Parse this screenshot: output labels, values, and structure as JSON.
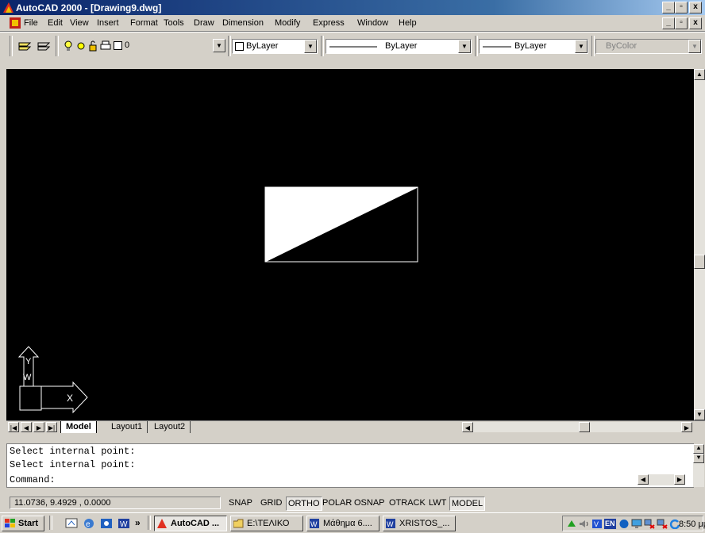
{
  "window": {
    "title": "AutoCAD 2000 - [Drawing9.dwg]"
  },
  "menu": {
    "items": [
      "File",
      "Edit",
      "View",
      "Insert",
      "Format",
      "Tools",
      "Draw",
      "Dimension",
      "Modify",
      "Express",
      "Window",
      "Help"
    ]
  },
  "toolbar": {
    "layer_value": "0",
    "color_value": "ByLayer",
    "linetype_value": "ByLayer",
    "lineweight_value": "ByLayer",
    "plotstyle_value": "ByColor"
  },
  "ucs": {
    "x_label": "X",
    "y_label": "Y",
    "w_label": "W"
  },
  "layout_tabs": [
    {
      "label": "Model",
      "active": true
    },
    {
      "label": "Layout1",
      "active": false
    },
    {
      "label": "Layout2",
      "active": false
    }
  ],
  "command": {
    "history": [
      "Select internal point:",
      "Select internal point:"
    ],
    "prompt": "Command:"
  },
  "status": {
    "coordinates": "11.0736, 9.4929 , 0.0000",
    "toggles": [
      {
        "label": "SNAP",
        "on": false
      },
      {
        "label": "GRID",
        "on": false
      },
      {
        "label": "ORTHO",
        "on": true
      },
      {
        "label": "POLAR",
        "on": false
      },
      {
        "label": "OSNAP",
        "on": false
      },
      {
        "label": "OTRACK",
        "on": false
      },
      {
        "label": "LWT",
        "on": false
      },
      {
        "label": "MODEL",
        "on": true
      }
    ]
  },
  "taskbar": {
    "start_label": "Start",
    "overflow": "»",
    "tasks": [
      {
        "label": "AutoCAD ...",
        "icon": "autocad-icon",
        "active": true
      },
      {
        "label": "E:\\ΤΕΛΙΚΟ",
        "icon": "folder-icon",
        "active": false
      },
      {
        "label": "Μάθημα 6....",
        "icon": "word-icon",
        "active": false
      },
      {
        "label": "XRISTOS_...",
        "icon": "word-icon",
        "active": false
      }
    ],
    "tray_lang": "EN",
    "clock": "8:50 μμ"
  }
}
